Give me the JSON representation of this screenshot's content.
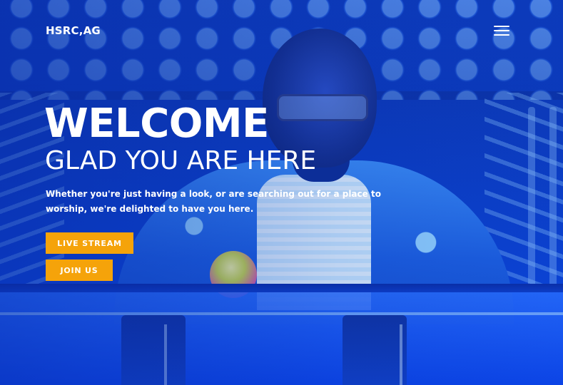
{
  "header": {
    "logo_text": "HSRC,AG",
    "menu_icon": "hamburger-menu-icon"
  },
  "hero": {
    "heading": "WELCOME",
    "subheading": "GLAD YOU ARE HERE",
    "lede": "Whether you're just having a look, or are searching out for a place to worship, we're delighted to have you here.",
    "buttons": {
      "live_stream": "LIVE STREAM",
      "join_us": "JOIN US"
    }
  },
  "colors": {
    "accent": "#f5a30a",
    "text": "#ffffff",
    "background_tint": "#0b47e0"
  }
}
